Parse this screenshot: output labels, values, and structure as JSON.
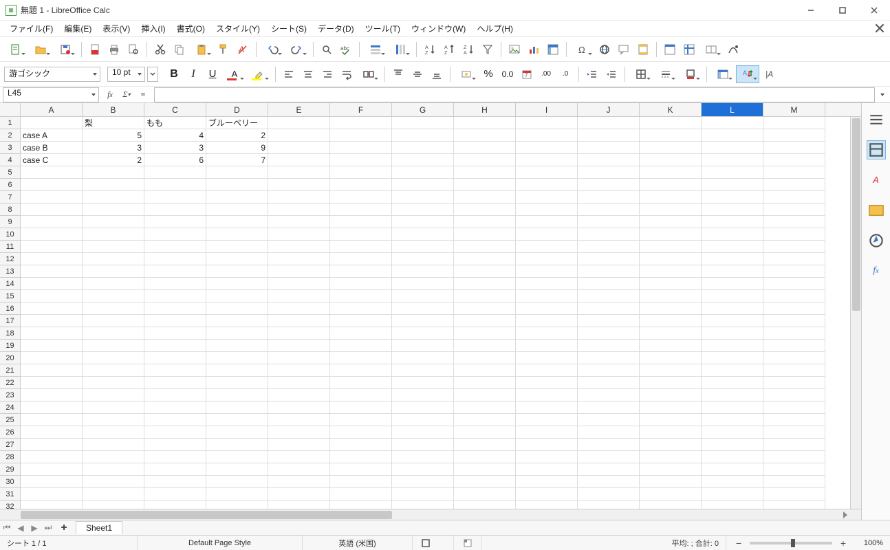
{
  "window": {
    "title": "無題 1 - LibreOffice Calc"
  },
  "menu": {
    "file": "ファイル(F)",
    "edit": "編集(E)",
    "view": "表示(V)",
    "insert": "挿入(I)",
    "format": "書式(O)",
    "style": "スタイル(Y)",
    "sheet": "シート(S)",
    "data": "データ(D)",
    "tool": "ツール(T)",
    "window": "ウィンドウ(W)",
    "help": "ヘルプ(H)"
  },
  "font": {
    "name": "游ゴシック",
    "size": "10 pt"
  },
  "namebox": "L45",
  "formula": "",
  "columns": [
    "A",
    "B",
    "C",
    "D",
    "E",
    "F",
    "G",
    "H",
    "I",
    "J",
    "K",
    "L",
    "M"
  ],
  "selected_column": "L",
  "rows_visible": 32,
  "cells": {
    "r1": {
      "B": "梨",
      "C": "もも",
      "D": "ブルーベリー"
    },
    "r2": {
      "A": "case A",
      "B": "5",
      "C": "4",
      "D": "2"
    },
    "r3": {
      "A": "case B",
      "B": "3",
      "C": "3",
      "D": "9"
    },
    "r4": {
      "A": "case C",
      "B": "2",
      "C": "6",
      "D": "7"
    }
  },
  "sheet_tab": "Sheet1",
  "status": {
    "sheet_count": "シート 1 / 1",
    "page_style": "Default Page Style",
    "language": "英語 (米国)",
    "insert_mode": "",
    "selection_summary": "平均: ; 合計: 0",
    "zoom": "100%"
  },
  "chart_data": {
    "type": "table",
    "columns": [
      "",
      "梨",
      "もも",
      "ブルーベリー"
    ],
    "rows": [
      [
        "case A",
        5,
        4,
        2
      ],
      [
        "case B",
        3,
        3,
        9
      ],
      [
        "case C",
        2,
        6,
        7
      ]
    ]
  }
}
